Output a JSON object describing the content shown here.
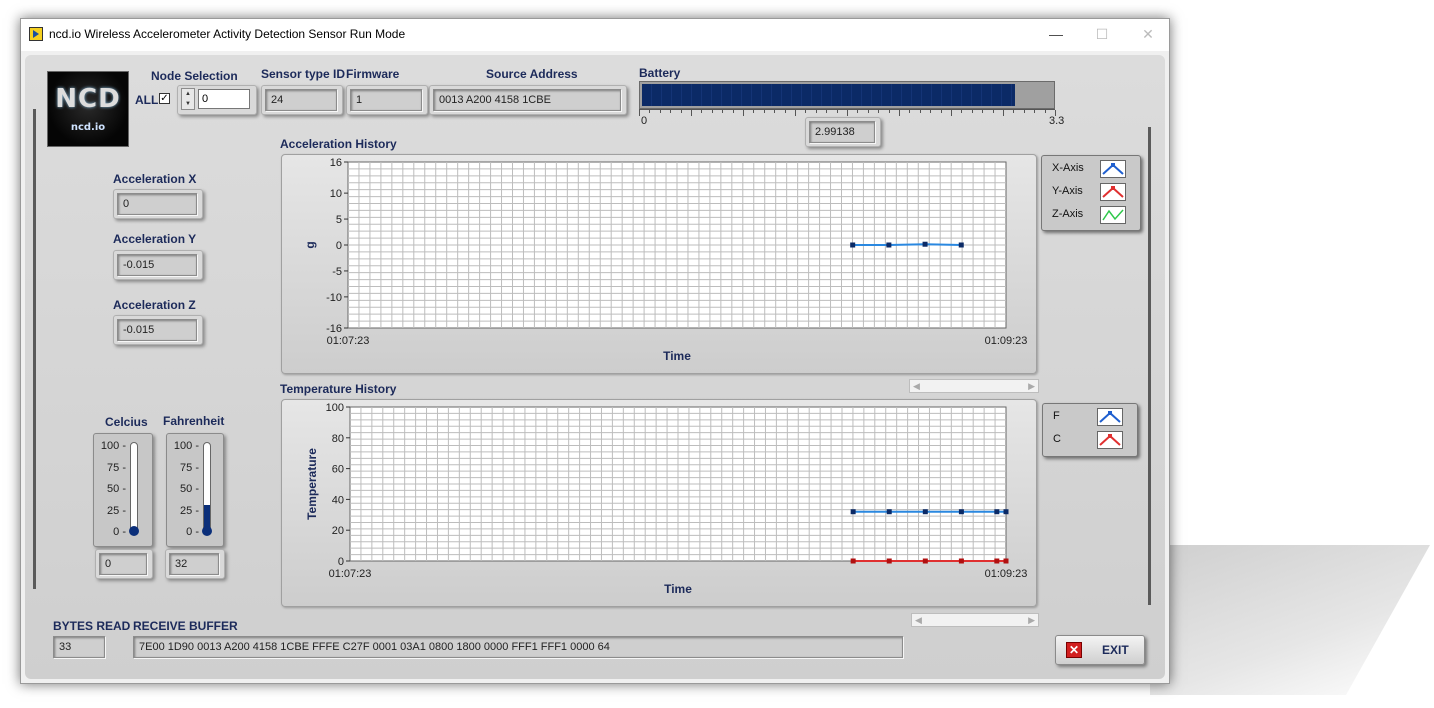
{
  "window": {
    "title": "ncd.io Wireless Accelerometer Activity Detection Sensor Run Mode",
    "min_glyph": "—",
    "max_glyph": "☐",
    "close_glyph": "✕"
  },
  "logo": {
    "big": "NCD",
    "small": "ncd.io"
  },
  "node_selection": {
    "label": "Node Selection",
    "all_label": "ALL",
    "all_checked": true,
    "check_glyph": "✓",
    "value": "0"
  },
  "sensor_type": {
    "label": "Sensor type ID",
    "value": "24"
  },
  "firmware": {
    "label": "Firmware",
    "value": "1"
  },
  "source_address": {
    "label": "Source Address",
    "value": "0013 A200 4158 1CBE"
  },
  "battery": {
    "label": "Battery",
    "min": "0",
    "max": "3.3",
    "value": 2.99138,
    "display": "2.99138",
    "color": "#0b2a66"
  },
  "accel": {
    "x_label": "Acceleration X",
    "x_value": "0",
    "y_label": "Acceleration Y",
    "y_value": "-0.015",
    "z_label": "Acceleration Z",
    "z_value": "-0.015"
  },
  "temps": {
    "celcius_label": "Celcius",
    "celcius_value": "0",
    "celcius_level": 0,
    "fahrenheit_label": "Fahrenheit",
    "fahrenheit_value": "32",
    "fahrenheit_level": 32,
    "scale": [
      "100",
      "75",
      "50",
      "25",
      "0"
    ],
    "fill_color": "#0b2f7a"
  },
  "legend_accel": [
    {
      "label": "X-Axis",
      "icon": "x-axis-line-icon",
      "color": "#1f5fcf"
    },
    {
      "label": "Y-Axis",
      "icon": "y-axis-line-icon",
      "color": "#e03030"
    },
    {
      "label": "Z-Axis",
      "icon": "z-axis-line-icon",
      "color": "#2ec84a"
    }
  ],
  "legend_temp": [
    {
      "label": "F",
      "icon": "fahrenheit-line-icon",
      "color": "#1f5fcf"
    },
    {
      "label": "C",
      "icon": "celcius-line-icon",
      "color": "#e03030"
    }
  ],
  "footer": {
    "bytes_read_label": "BYTES READ",
    "bytes_read_value": "33",
    "receive_buffer_label": "RECEIVE BUFFER",
    "receive_buffer_value": "7E00 1D90 0013 A200 4158 1CBE FFFE C27F 0001 03A1 0800 1800 0000 FFF1 FFF1 0000 64",
    "exit_label": "EXIT",
    "exit_glyph": "✕"
  },
  "chart_data": [
    {
      "type": "line",
      "title": "Acceleration History",
      "xlabel": "Time",
      "ylabel": "g",
      "x_range": [
        "01:07:23",
        "01:09:23"
      ],
      "ylim": [
        -16,
        16
      ],
      "yticks": [
        16,
        10,
        5,
        0,
        -5,
        -10,
        -16
      ],
      "grid": true,
      "series": [
        {
          "name": "X-Axis",
          "color": "#2a88e0",
          "points": [
            [
              0.767,
              0
            ],
            [
              0.822,
              0
            ],
            [
              0.877,
              0.15
            ],
            [
              0.932,
              0
            ]
          ]
        }
      ]
    },
    {
      "type": "line",
      "title": "Temperature History",
      "xlabel": "Time",
      "ylabel": "Temperature",
      "x_range": [
        "01:07:23",
        "01:09:23"
      ],
      "ylim": [
        0,
        100
      ],
      "yticks": [
        100,
        80,
        60,
        40,
        20,
        0
      ],
      "grid": true,
      "series": [
        {
          "name": "F",
          "color": "#2a88e0",
          "points": [
            [
              0.767,
              32
            ],
            [
              0.822,
              32
            ],
            [
              0.877,
              32
            ],
            [
              0.932,
              32
            ],
            [
              0.986,
              32
            ],
            [
              1.0,
              32
            ]
          ]
        },
        {
          "name": "C",
          "color": "#e03030",
          "points": [
            [
              0.767,
              0
            ],
            [
              0.822,
              0
            ],
            [
              0.877,
              0
            ],
            [
              0.932,
              0
            ],
            [
              0.986,
              0
            ],
            [
              1.0,
              0
            ]
          ]
        }
      ]
    }
  ]
}
